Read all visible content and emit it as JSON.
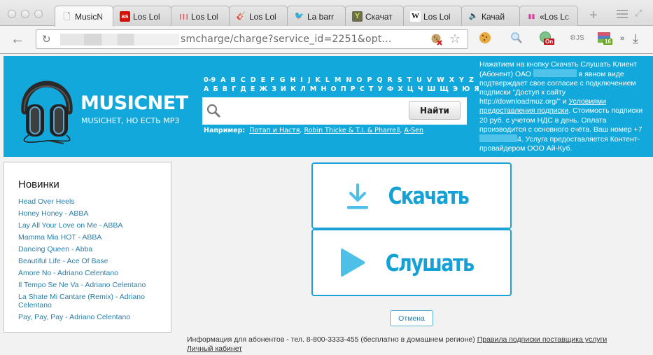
{
  "browser": {
    "tabs": [
      {
        "title": "MusicN",
        "favicon": "page-icon",
        "active": true
      },
      {
        "title": "Los Lol",
        "favicon": "lastfm-icon"
      },
      {
        "title": "Los Lol",
        "favicon": "bars-icon"
      },
      {
        "title": "Los Lol",
        "favicon": "guitar-icon"
      },
      {
        "title": "La barr",
        "favicon": "bird-icon"
      },
      {
        "title": "Скачат",
        "favicon": "tuning-fork-icon"
      },
      {
        "title": "Los Lol",
        "favicon": "wikipedia-icon"
      },
      {
        "title": "Качай",
        "favicon": "speaker-icon"
      },
      {
        "title": "«Los Lc",
        "favicon": "equalizer-icon"
      }
    ],
    "new_tab_label": "+",
    "url_visible": "smcharge/charge?service_id=2251&opt…",
    "extensions": [
      {
        "name": "cookie-extension"
      },
      {
        "name": "search-extension"
      },
      {
        "name": "globe-extension",
        "badge": "On",
        "badge_color": "#c9121b"
      },
      {
        "name": "javascript-extension"
      },
      {
        "name": "tabs-extension",
        "badge": "16",
        "badge_color": "#6aa520"
      }
    ],
    "overflow_label": "»"
  },
  "site": {
    "brand": "MUSICNET",
    "tagline": "MUSICHET, HO ECTЬ MP3",
    "accent_color": "#12a8db",
    "latin_letters": [
      "0-9",
      "A",
      "B",
      "C",
      "D",
      "E",
      "F",
      "G",
      "H",
      "I",
      "J",
      "K",
      "L",
      "M",
      "N",
      "O",
      "P",
      "Q",
      "R",
      "S",
      "T",
      "U",
      "V",
      "W",
      "X",
      "Y",
      "Z"
    ],
    "cyrillic_letters": [
      "А",
      "Б",
      "В",
      "Г",
      "Д",
      "Е",
      "Ж",
      "З",
      "И",
      "К",
      "Л",
      "М",
      "Н",
      "О",
      "П",
      "Р",
      "С",
      "Т",
      "У",
      "Ф",
      "Х",
      "Ц",
      "Ч",
      "Ш",
      "Щ",
      "Э",
      "Ю",
      "Я"
    ],
    "search": {
      "placeholder": "",
      "value": "",
      "button_label": "Найти"
    },
    "examples": {
      "label": "Например:",
      "links": [
        "Потап и Настя",
        "Robin Thicke & T.I. & Pharrell",
        "A-Sen"
      ]
    },
    "legal": {
      "part1": "Нажатием на кнопку Скачать Слушать Клиент (Абонент) ОАО",
      "part2": "в явном виде подтверждает свое согласие с подключением подписки \"Доступ к сайту http://downloadmuz.org/\" и",
      "terms_link": "Условиями предоставления подписки",
      "part3": ". Стоимость подписки 20 руб. с учетом НДС в день. Оплата производится с основного счёта. Ваш номер +7",
      "part4": "4. Услуга предоставляется Контент-провайдером ООО Ай-Куб."
    }
  },
  "sidebar": {
    "title": "Новинки",
    "items": [
      "Head Over Heels",
      "Honey Honey - ABBA",
      "Lay All Your Love on Me - ABBA",
      "Mamma Mia HOT - ABBA",
      "Dancing Queen - Abba",
      "Beautiful Life - Ace Of Base",
      "Amore No - Adriano Celentano",
      "Il Tempo Se Ne Va - Adriano Celentano",
      "La Shate Mi Cantare (Remix) - Adriano Celentano",
      "Pay, Pay, Pay - Adriano Celentano"
    ]
  },
  "main": {
    "download_label": "Скачать",
    "listen_label": "Слушать",
    "cancel_label": "Отмена"
  },
  "footer": {
    "info": "Информация для абонентов - тел. 8-800-3333-455 (бесплатно в домашнем регионе)",
    "rules_link": "Правила подписки поставщика услуги",
    "cabinet_link": "Личный кабинет"
  }
}
